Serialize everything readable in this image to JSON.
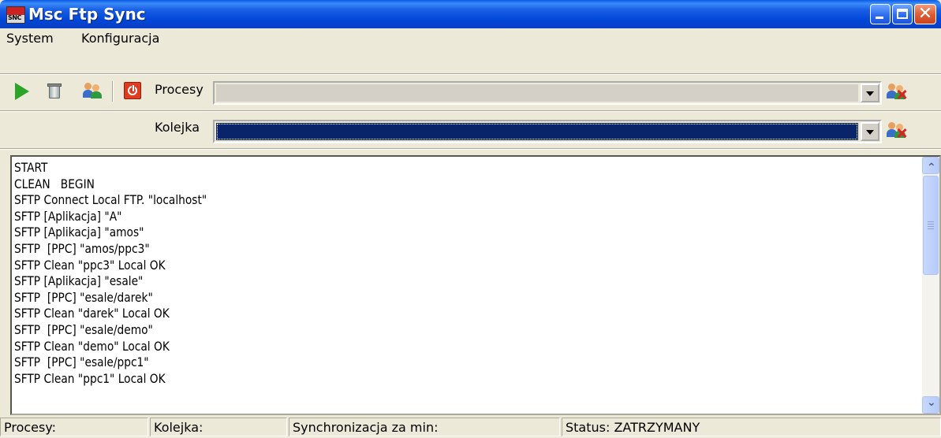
{
  "window": {
    "title": "Msc Ftp Sync",
    "icon_label": "SNC",
    "controls": [
      "minimize-icon",
      "maximize-icon",
      "close-icon"
    ],
    "close_glyph": "✕"
  },
  "menu": {
    "items": [
      "System",
      "Konfiguracja"
    ]
  },
  "toolbar": {
    "buttons": [
      "play-icon",
      "recycle-bin-icon",
      "users-icon",
      "power-icon"
    ],
    "procesy": {
      "label": "Procesy",
      "value": ""
    },
    "kolejka": {
      "label": "Kolejka",
      "value": ""
    }
  },
  "log": {
    "lines": [
      "START",
      "CLEAN   BEGIN",
      "SFTP Connect Local FTP. \"localhost\"",
      "SFTP [Aplikacja] \"A\"",
      "SFTP [Aplikacja] \"amos\"",
      "SFTP  [PPC] \"amos/ppc3\"",
      "SFTP Clean \"ppc3\" Local OK",
      "SFTP [Aplikacja] \"esale\"",
      "SFTP  [PPC] \"esale/darek\"",
      "SFTP Clean \"darek\" Local OK",
      "SFTP  [PPC] \"esale/demo\"",
      "SFTP Clean \"demo\" Local OK",
      "SFTP  [PPC] \"esale/ppc1\"",
      "SFTP Clean \"ppc1\" Local OK"
    ],
    "scroll_up_glyph": "⌃",
    "scroll_down_glyph": "⌄"
  },
  "status": {
    "procesy": "Procesy:",
    "kolejka": "Kolejka:",
    "sync": "Synchronizacja za min:",
    "state": "Status: ZATRZYMANY"
  }
}
